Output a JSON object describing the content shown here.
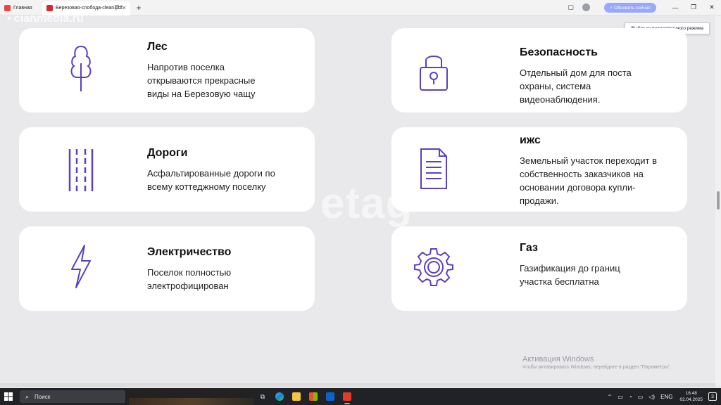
{
  "browser": {
    "tabs": [
      {
        "label": "Главная",
        "active": false
      },
      {
        "label": "Березовая-слобода-clean.pdf",
        "active": true
      }
    ],
    "update_button": "Обновить сейчас",
    "tooltip": "Выйти из полноэкранного режима"
  },
  "watermarks": {
    "top": "• cianmedia.ru",
    "middle": "etag"
  },
  "cards": [
    {
      "title": "Лес",
      "desc": "Напротив поселка открываются прекрасные виды на Березовую чащу",
      "icon": "tree-icon"
    },
    {
      "title": "Безопасность",
      "desc": "Отдельный дом для поста охраны, система видеонаблюдения.",
      "icon": "lock-icon"
    },
    {
      "title": "Дороги",
      "desc": "Асфальтированные дороги по всему коттеджному поселку",
      "icon": "road-icon"
    },
    {
      "title": "ижс",
      "desc": "Земельный участок переходит в собственность заказчиков на основании договора купли-продажи.",
      "icon": "document-icon"
    },
    {
      "title": "Электричество",
      "desc": "Поселок полностью электрофицирован",
      "icon": "lightning-icon"
    },
    {
      "title": "Газ",
      "desc": "Газификация до границ участка бесплатна",
      "icon": "gear-icon"
    }
  ],
  "activation": {
    "title": "Активация Windows",
    "subtitle": "Чтобы активировать Windows, перейдите в раздел \"Параметры\"."
  },
  "taskbar": {
    "search_placeholder": "Поиск",
    "language": "ENG",
    "time": "16:48",
    "date": "02.04.2025",
    "notifications": "3"
  },
  "colors": {
    "icon": "#5b3fc4",
    "card_bg": "#ffffff",
    "page_bg": "#e9e9ec"
  }
}
